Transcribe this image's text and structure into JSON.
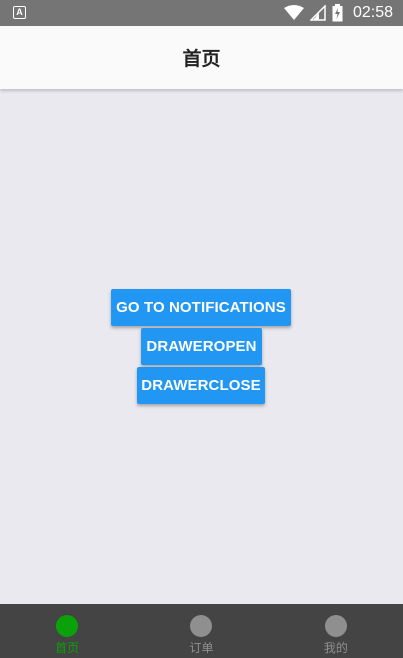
{
  "status_bar": {
    "app_icon_letter": "A",
    "time": "02:58"
  },
  "header": {
    "title": "首页"
  },
  "buttons": {
    "go_to_notifications": "GO TO NOTIFICATIONS",
    "drawer_open": "DRAWEROPEN",
    "drawer_close": "DRAWERCLOSE"
  },
  "tabs": [
    {
      "label": "首页",
      "active": true
    },
    {
      "label": "订单",
      "active": false
    },
    {
      "label": "我的",
      "active": false
    }
  ],
  "colors": {
    "primary_button": "#2196f3",
    "active_tab": "#0aa10a",
    "inactive_tab": "#8f8f8f",
    "tab_bar_bg": "#444444"
  }
}
